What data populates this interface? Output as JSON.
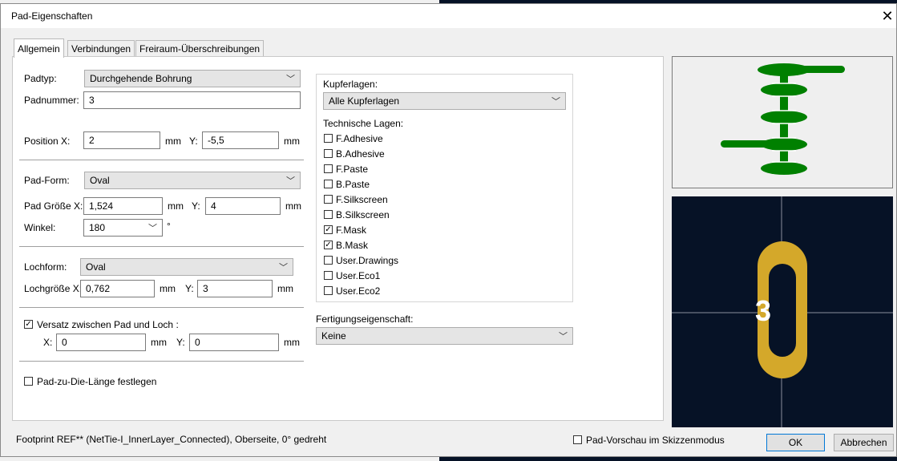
{
  "dialog": {
    "title": "Pad-Eigenschaften",
    "close_glyph": "✕"
  },
  "tabs": [
    "Allgemein",
    "Verbindungen",
    "Freiraum-Überschreibungen"
  ],
  "form": {
    "padtyp_label": "Padtyp:",
    "padtyp_value": "Durchgehende Bohrung",
    "padnummer_label": "Padnummer:",
    "padnummer_value": "3",
    "position_x_label": "Position X:",
    "position_x_value": "2",
    "position_y_label": "Y:",
    "position_y_value": "-5,5",
    "unit": "mm",
    "padform_label": "Pad-Form:",
    "padform_value": "Oval",
    "padsize_x_label": "Pad Größe X:",
    "padsize_x_value": "1,524",
    "padsize_y_label": "Y:",
    "padsize_y_value": "4",
    "winkel_label": "Winkel:",
    "winkel_value": "180",
    "winkel_unit": "°",
    "lochform_label": "Lochform:",
    "lochform_value": "Oval",
    "lochsize_x_label": "Lochgröße X:",
    "lochsize_x_value": "0,762",
    "lochsize_y_label": "Y:",
    "lochsize_y_value": "3",
    "offset_label": "Versatz zwischen Pad und Loch  :",
    "offset_checked": true,
    "offset_x_label": "X:",
    "offset_x_value": "0",
    "offset_y_label": "Y:",
    "offset_y_value": "0",
    "pad_die_label": "Pad-zu-Die-Länge festlegen",
    "pad_die_checked": false
  },
  "layers": {
    "copper_label": "Kupferlagen:",
    "copper_value": "Alle Kupferlagen",
    "tech_label": "Technische Lagen:",
    "items": [
      {
        "name": "F.Adhesive",
        "checked": false
      },
      {
        "name": "B.Adhesive",
        "checked": false
      },
      {
        "name": "F.Paste",
        "checked": false
      },
      {
        "name": "B.Paste",
        "checked": false
      },
      {
        "name": "F.Silkscreen",
        "checked": false
      },
      {
        "name": "B.Silkscreen",
        "checked": false
      },
      {
        "name": "F.Mask",
        "checked": true
      },
      {
        "name": "B.Mask",
        "checked": true
      },
      {
        "name": "User.Drawings",
        "checked": false
      },
      {
        "name": "User.Eco1",
        "checked": false
      },
      {
        "name": "User.Eco2",
        "checked": false
      }
    ],
    "fab_label": "Fertigungseigenschaft:",
    "fab_value": "Keine"
  },
  "preview": {
    "pad_number": "3",
    "sketch_mode_label": "Pad-Vorschau im Skizzenmodus",
    "sketch_mode_checked": false
  },
  "footer": {
    "status": "Footprint REF** (NetTie-I_InnerLayer_Connected), Oberseite, 0° gedreht",
    "ok": "OK",
    "cancel": "Abbrechen"
  },
  "colors": {
    "pad_green": "#008000",
    "pad_gold": "#d4a82a",
    "canvas": "#061226"
  }
}
